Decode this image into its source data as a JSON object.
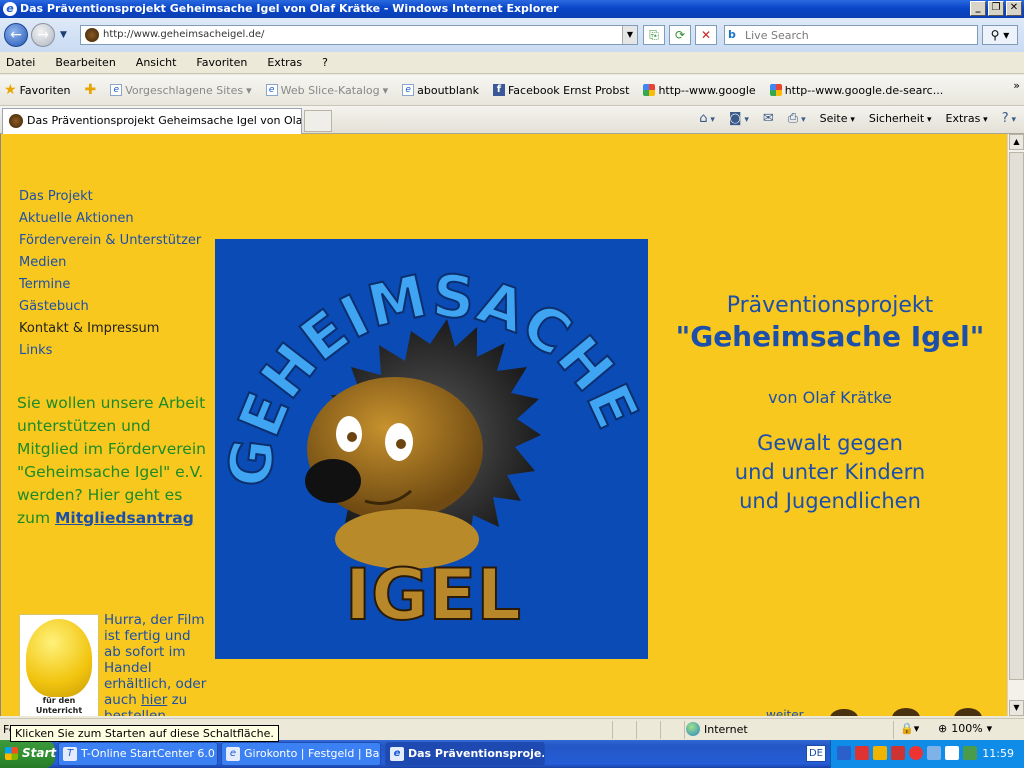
{
  "window": {
    "title": "Das Präventionsprojekt Geheimsache Igel von Olaf Krätke - Windows Internet Explorer"
  },
  "address_bar": {
    "url": "http://www.geheimsacheigel.de/",
    "search_placeholder": "Live Search"
  },
  "menu": [
    "Datei",
    "Bearbeiten",
    "Ansicht",
    "Favoriten",
    "Extras",
    "?"
  ],
  "favorites_bar": {
    "favorites_label": "Favoriten",
    "items": [
      "Vorgeschlagene Sites",
      "Web Slice-Katalog",
      "aboutblank",
      "Facebook  Ernst Probst",
      "http--www.google",
      "http--www.google.de-searc..."
    ]
  },
  "tab": {
    "title": "Das Präventionsprojekt Geheimsache Igel von Olaf Kr..."
  },
  "command_bar": [
    "Seite",
    "Sicherheit",
    "Extras"
  ],
  "page": {
    "nav": [
      "Das Projekt",
      "Aktuelle Aktionen",
      "Förderverein & Unterstützer",
      "Medien",
      "Termine",
      "Gästebuch",
      "Kontakt & Impressum",
      "Links"
    ],
    "promo_text": "Sie wollen unsere Arbeit unterstützen und Mitglied im Förderverein \"Geheimsache Igel\" e.V. werden? Hier geht es zum ",
    "promo_link": "Mitgliedsantrag",
    "badge_text": "für den Unterricht empfohlen",
    "hurra_text_1": "Hurra, der Film ist fertig und ab sofort im Handel erhältlich, oder auch ",
    "hurra_link": "hier",
    "hurra_text_2": " zu bestellen.",
    "logo_word_top": "GEHEIMSACHE",
    "logo_word_bottom": "IGEL",
    "info_line1": "Präventionsprojekt",
    "info_line2": "\"Geheimsache Igel\"",
    "info_author": "von Olaf Krätke",
    "info_topic_1": "Gewalt gegen",
    "info_topic_2": "und unter Kindern",
    "info_topic_3": "und Jugendlichen",
    "weiter": "weiter"
  },
  "status_bar": {
    "left_text": "Fe",
    "tooltip": "Klicken Sie zum Starten auf diese Schaltfläche.",
    "zone": "Internet",
    "zoom": "100%"
  },
  "taskbar": {
    "start": "Start",
    "tasks": [
      "T-Online StartCenter 6.0",
      "Girokonto | Festgeld | Ba...",
      "Das Präventionsproje..."
    ],
    "language": "DE",
    "clock": "11:59"
  },
  "colors": {
    "page_background": "#f8c81e",
    "link_blue": "#1c4faa",
    "promo_green": "#1d8a28",
    "logo_background": "#0a4bb5"
  }
}
